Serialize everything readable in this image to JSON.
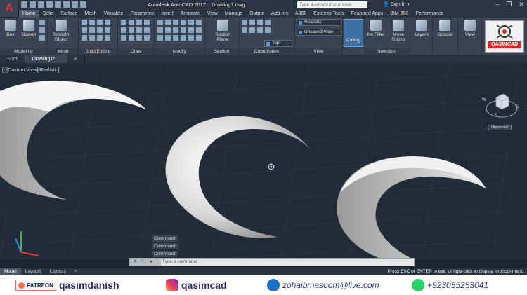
{
  "window": {
    "app_title": "Autodesk AutoCAD 2017",
    "doc_title": "Drawing1.dwg",
    "search_placeholder": "Type a keyword or phrase",
    "signin": "Sign In"
  },
  "ribbon_tabs": [
    "Home",
    "Solid",
    "Surface",
    "Mesh",
    "Visualize",
    "Parametric",
    "Insert",
    "Annotate",
    "View",
    "Manage",
    "Output",
    "Add-ins",
    "A360",
    "Express Tools",
    "Featured Apps",
    "BIM 360",
    "Performance"
  ],
  "ribbon": {
    "box": "Box",
    "sweep": "Sweep",
    "smooth_object": "Smooth Object",
    "section_plane": "Section Plane",
    "visual_style": "Realistic",
    "view_saved": "Unsaved View",
    "view_top": "Top",
    "culling": "Culling",
    "no_filter": "No Filter",
    "move_gizmo": "Move Gizmo",
    "layers": "Layers",
    "groups": "Groups",
    "view_btn": "View",
    "panels": {
      "modeling": "Modeling",
      "mesh": "Mesh",
      "solid_editing": "Solid Editing",
      "draw": "Draw",
      "modify": "Modify",
      "section": "Section",
      "coordinates": "Coordinates",
      "view": "View",
      "selection": "Selection"
    }
  },
  "brand_logo": "QASIMCAD",
  "file_tabs": [
    "Start",
    "Drawing1*"
  ],
  "viewport": {
    "label": "[-][Custom View][Realistic]",
    "unnamed": "Unnamed",
    "compass": {
      "w": "W",
      "e": "E",
      "s": "S"
    }
  },
  "command_history": [
    "Command:",
    "Command:",
    "Command:"
  ],
  "command_placeholder": "Type a command",
  "layout_tabs": [
    "Model",
    "Layout1",
    "Layout2"
  ],
  "status_message": "Press ESC or ENTER to exit, or right-click to display shortcut-menu.",
  "footer": {
    "patreon_label": "PATREON",
    "patreon_name": "qasimdanish",
    "instagram_name": "qasimcad",
    "email": "zohaibmasoom@live.com",
    "phone": "+923055253041"
  },
  "colors": {
    "viewport_bg": "#222b38",
    "ribbon_bg": "#3b4453",
    "accent_red": "#d42a2a",
    "culling_active": "#3d6fa3"
  }
}
